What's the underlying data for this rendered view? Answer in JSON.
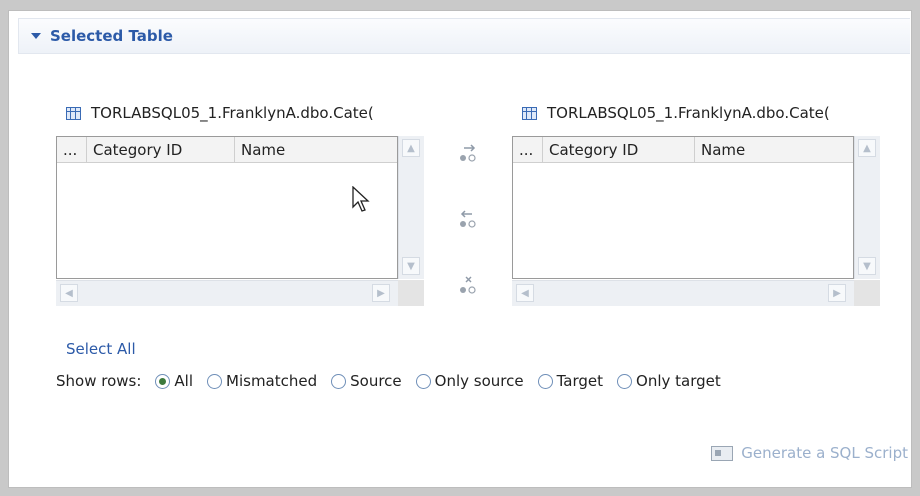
{
  "section": {
    "title": "Selected Table"
  },
  "left_table": {
    "title": "TORLABSQL05_1.FranklynA.dbo.Cate(",
    "columns": [
      "...",
      "Category ID",
      "Name"
    ]
  },
  "right_table": {
    "title": "TORLABSQL05_1.FranklynA.dbo.Cate(",
    "columns": [
      "...",
      "Category ID",
      "Name"
    ]
  },
  "actions": {
    "select_all": "Select All",
    "generate_script": "Generate a SQL Script"
  },
  "show_rows": {
    "label": "Show rows:",
    "options": [
      "All",
      "Mismatched",
      "Source",
      "Only source",
      "Target",
      "Only target"
    ],
    "selected": "All"
  },
  "icons": {
    "section_toggle": "collapse-triangle-icon",
    "table": "table-icon",
    "copy_right": "copy-to-target-icon",
    "copy_left": "copy-to-source-icon",
    "delete": "delete-row-icon",
    "script": "sql-script-icon"
  },
  "colors": {
    "accent": "#2c5aa8",
    "disabled_text": "#9bb0cc"
  }
}
